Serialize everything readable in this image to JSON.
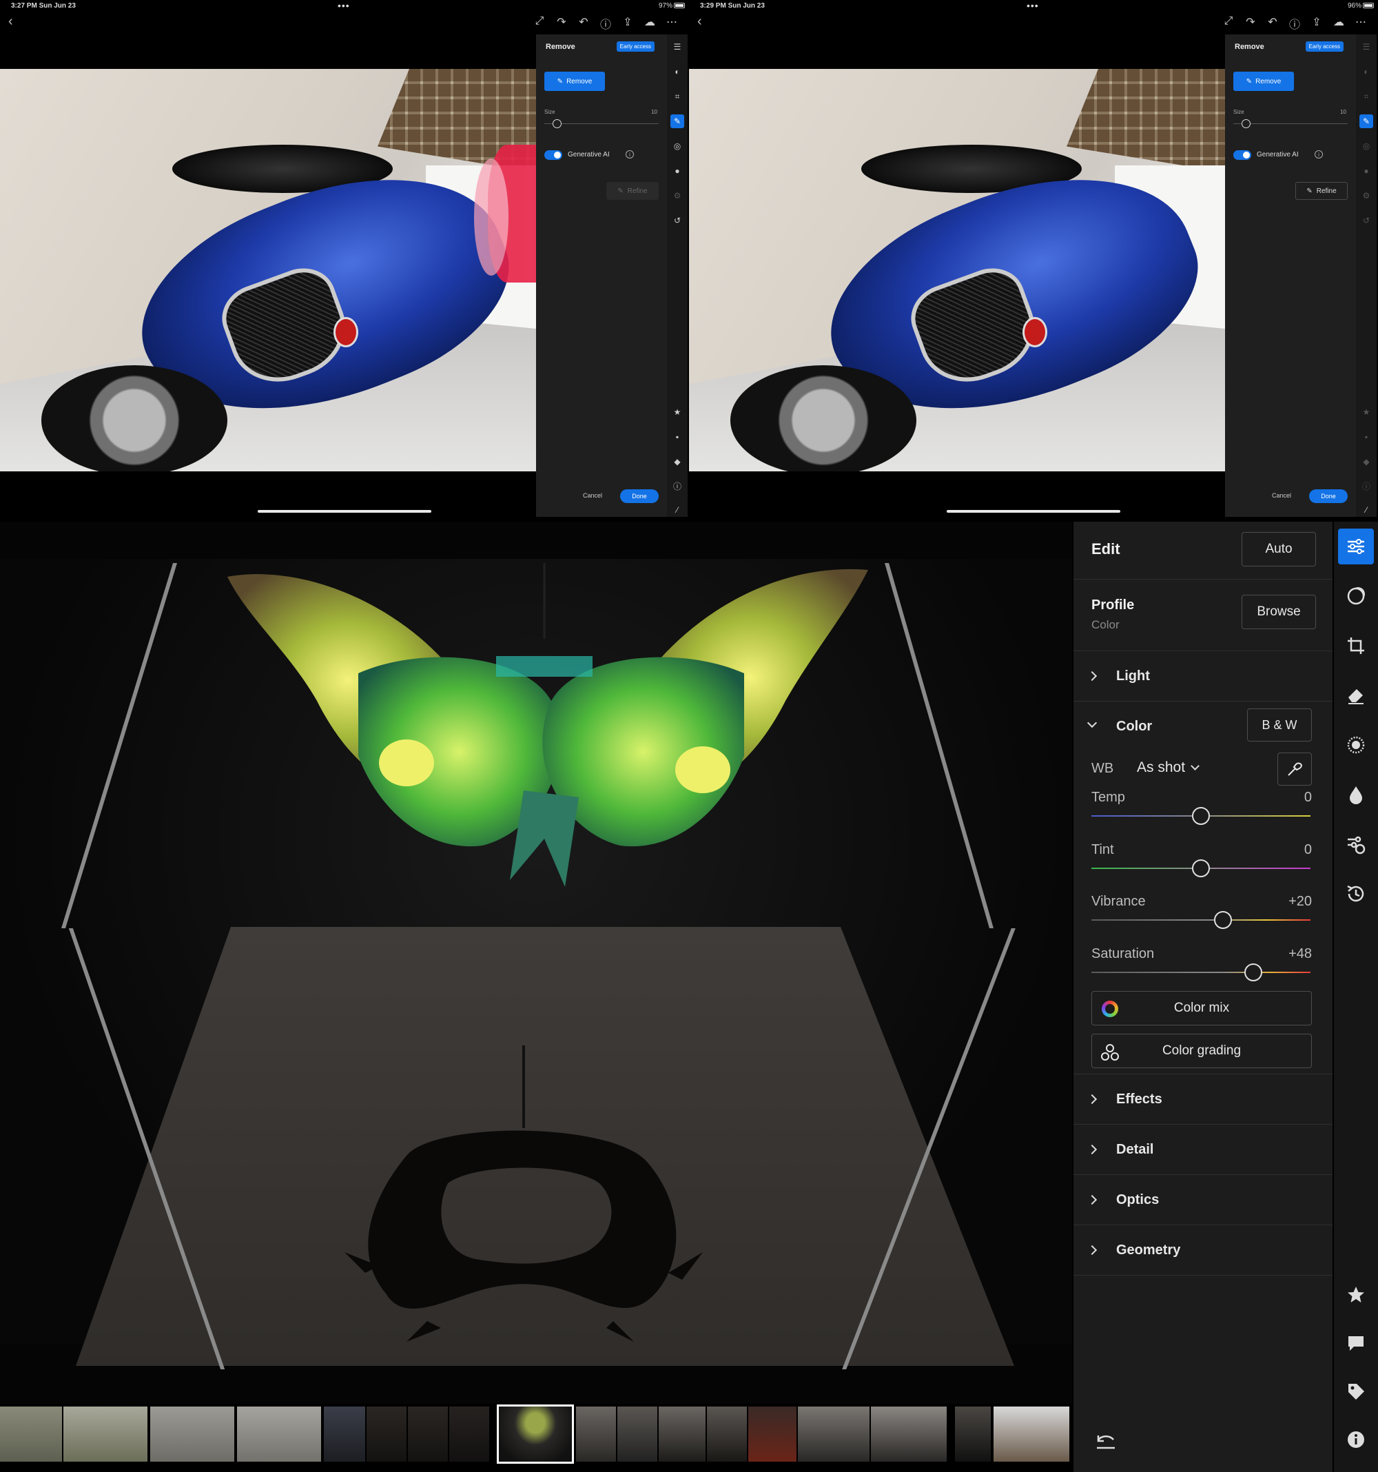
{
  "screens": [
    {
      "status": {
        "time": "3:27 PM   Sun Jun 23",
        "battery": "97%"
      },
      "panel": {
        "title": "Remove",
        "badge": "Early access",
        "remove_button": "Remove",
        "size_label": "Size",
        "size_value": "10",
        "genai_label": "Generative AI",
        "refine_label": "Refine",
        "refine_enabled": false,
        "cancel_label": "Cancel",
        "done_label": "Done"
      }
    },
    {
      "status": {
        "time": "3:29 PM   Sun Jun 23",
        "battery": "96%"
      },
      "panel": {
        "title": "Remove",
        "badge": "Early access",
        "remove_button": "Remove",
        "size_label": "Size",
        "size_value": "10",
        "genai_label": "Generative AI",
        "refine_label": "Refine",
        "refine_enabled": true,
        "cancel_label": "Cancel",
        "done_label": "Done"
      }
    }
  ],
  "edit": {
    "title": "Edit",
    "auto_label": "Auto",
    "profile": {
      "label": "Profile",
      "value": "Color",
      "browse_label": "Browse"
    },
    "light_label": "Light",
    "color": {
      "label": "Color",
      "bw_label": "B & W",
      "wb_label": "WB",
      "wb_value": "As shot",
      "sliders": [
        {
          "name": "Temp",
          "value": "0",
          "fraction": 0.5
        },
        {
          "name": "Tint",
          "value": "0",
          "fraction": 0.5
        },
        {
          "name": "Vibrance",
          "value": "+20",
          "fraction": 0.6
        },
        {
          "name": "Saturation",
          "value": "+48",
          "fraction": 0.74
        }
      ],
      "color_mix_label": "Color mix",
      "color_grading_label": "Color grading"
    },
    "effects_label": "Effects",
    "detail_label": "Detail",
    "optics_label": "Optics",
    "geometry_label": "Geometry"
  },
  "colors": {
    "accent": "#1473e6",
    "panel": "#1c1c1c",
    "mask": "#e82348"
  },
  "icons": {
    "tool_rail": [
      "sliders-icon",
      "mask-icon",
      "crop-icon",
      "eraser-icon",
      "blur-icon",
      "drop-icon",
      "presets-icon",
      "history-icon"
    ],
    "lower_rail": [
      "star-icon",
      "comment-icon",
      "tag-icon",
      "info-icon"
    ]
  }
}
